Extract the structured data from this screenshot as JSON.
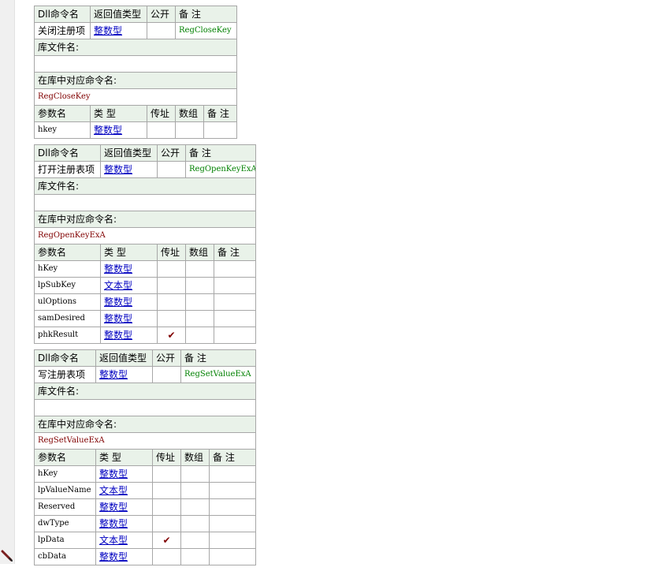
{
  "headers": {
    "dll_name": "Dll命令名",
    "return_type": "返回值类型",
    "public": "公开",
    "remark": "备 注",
    "lib_file": "库文件名:",
    "lib_cmd": "在库中对应命令名:",
    "param_name": "参数名",
    "type": "类 型",
    "by_ref": "传址",
    "array": "数组"
  },
  "check_mark": "✔",
  "blocks": [
    {
      "name": "关闭注册项",
      "return_type": "整数型",
      "public": "",
      "remark": "RegCloseKey",
      "lib_file": "",
      "lib_cmd": "RegCloseKey",
      "params": [
        {
          "name": "hkey",
          "type": "整数型",
          "by_ref": false,
          "array": false,
          "remark": ""
        }
      ]
    },
    {
      "name": "打开注册表项",
      "return_type": "整数型",
      "public": "",
      "remark": "RegOpenKeyExA",
      "lib_file": "",
      "lib_cmd": "RegOpenKeyExA",
      "params": [
        {
          "name": "hKey",
          "type": "整数型",
          "by_ref": false,
          "array": false,
          "remark": ""
        },
        {
          "name": "lpSubKey",
          "type": "文本型",
          "by_ref": false,
          "array": false,
          "remark": ""
        },
        {
          "name": "ulOptions",
          "type": "整数型",
          "by_ref": false,
          "array": false,
          "remark": ""
        },
        {
          "name": "samDesired",
          "type": "整数型",
          "by_ref": false,
          "array": false,
          "remark": ""
        },
        {
          "name": "phkResult",
          "type": "整数型",
          "by_ref": true,
          "array": false,
          "remark": ""
        }
      ]
    },
    {
      "name": "写注册表项",
      "return_type": "整数型",
      "public": "",
      "remark": "RegSetValueExA",
      "lib_file": "",
      "lib_cmd": "RegSetValueExA",
      "params": [
        {
          "name": "hKey",
          "type": "整数型",
          "by_ref": false,
          "array": false,
          "remark": ""
        },
        {
          "name": "lpValueName",
          "type": "文本型",
          "by_ref": false,
          "array": false,
          "remark": ""
        },
        {
          "name": "Reserved",
          "type": "整数型",
          "by_ref": false,
          "array": false,
          "remark": ""
        },
        {
          "name": "dwType",
          "type": "整数型",
          "by_ref": false,
          "array": false,
          "remark": ""
        },
        {
          "name": "lpData",
          "type": "文本型",
          "by_ref": true,
          "array": false,
          "remark": ""
        },
        {
          "name": "cbData",
          "type": "整数型",
          "by_ref": false,
          "array": false,
          "remark": ""
        }
      ]
    }
  ]
}
